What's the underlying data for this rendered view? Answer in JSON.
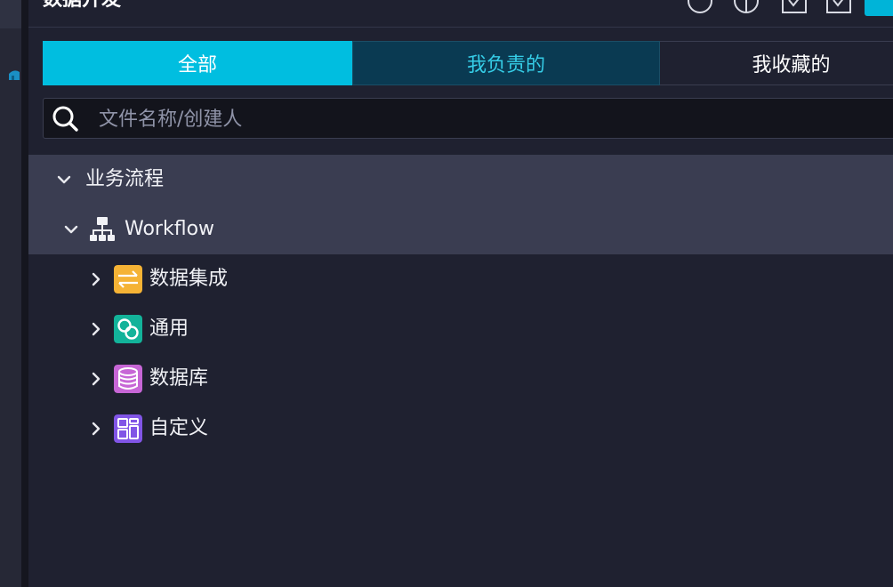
{
  "panel": {
    "title": "数据开发"
  },
  "tabs": [
    {
      "label": "全部",
      "active": true
    },
    {
      "label": "我负责的",
      "active": false
    },
    {
      "label": "我收藏的",
      "active": false
    }
  ],
  "search": {
    "placeholder": "文件名称/创建人",
    "value": ""
  },
  "tree": {
    "root": {
      "label": "业务流程",
      "expanded": true
    },
    "workflow": {
      "label": "Workflow",
      "expanded": true,
      "icon": "org-chart-icon"
    },
    "children": [
      {
        "label": "数据集成",
        "icon": "swap-arrows-icon",
        "color": "#f5b335"
      },
      {
        "label": "通用",
        "icon": "link-icon",
        "color": "#13b39a"
      },
      {
        "label": "数据库",
        "icon": "database-icon",
        "color": "#c766d6"
      },
      {
        "label": "自定义",
        "icon": "layout-icon",
        "color": "#8155e6"
      }
    ]
  },
  "colors": {
    "accent": "#00bee0",
    "background": "#1f2130",
    "highlight_row": "#3a3d51"
  }
}
